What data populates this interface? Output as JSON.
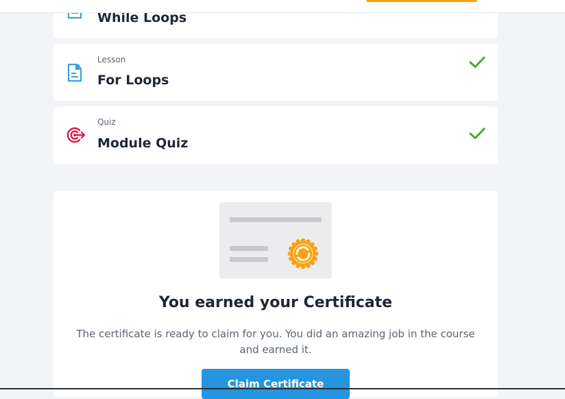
{
  "modules": [
    {
      "type": "",
      "title": "While Loops",
      "icon": "document-icon",
      "completed": false
    },
    {
      "type": "Lesson",
      "title": "For Loops",
      "icon": "document-icon",
      "completed": true
    },
    {
      "type": "Quiz",
      "title": "Module Quiz",
      "icon": "target-icon",
      "completed": true
    }
  ],
  "certificate": {
    "title": "You earned your Certificate",
    "description": "The certificate is ready to claim for you. You did an amazing job in the course and earned it.",
    "claim_label": "Claim Certificate"
  },
  "colors": {
    "lesson_icon": "#3b9ee8",
    "quiz_icon": "#e0194f",
    "check": "#3fae29",
    "button": "#2595e0",
    "seal": "#f7a21a"
  }
}
